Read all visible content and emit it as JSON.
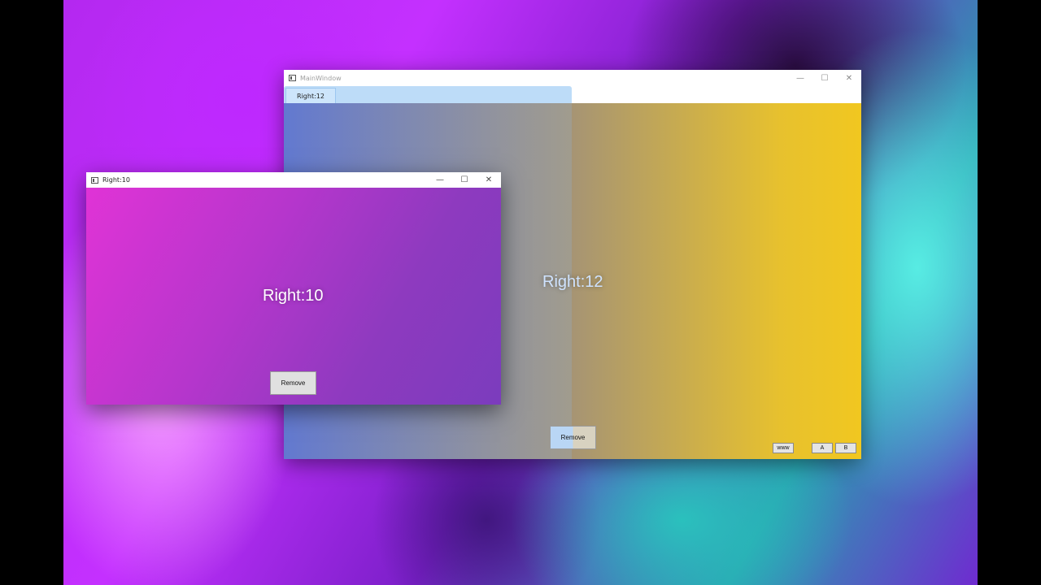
{
  "main_window": {
    "title": "MainWindow",
    "minimize": "—",
    "maximize": "☐",
    "close": "✕",
    "tab_label": "Right:12",
    "content_label": "Right:12",
    "remove_label": "Remove",
    "btn_www": "www",
    "btn_a": "A",
    "btn_b": "B"
  },
  "second_window": {
    "title": "Right:10",
    "minimize": "—",
    "maximize": "☐",
    "close": "✕",
    "content_label": "Right:10",
    "remove_label": "Remove"
  },
  "icons": {
    "app": "app-window-icon",
    "minimize": "minimize-icon",
    "maximize": "maximize-icon",
    "close": "close-icon"
  },
  "colors": {
    "main_gradient_start": "#5b6fd3",
    "main_gradient_end": "#f1c720",
    "second_gradient_start": "#e033d6",
    "second_gradient_end": "#7b3cbd",
    "tab_highlight": "#bddcf8"
  }
}
